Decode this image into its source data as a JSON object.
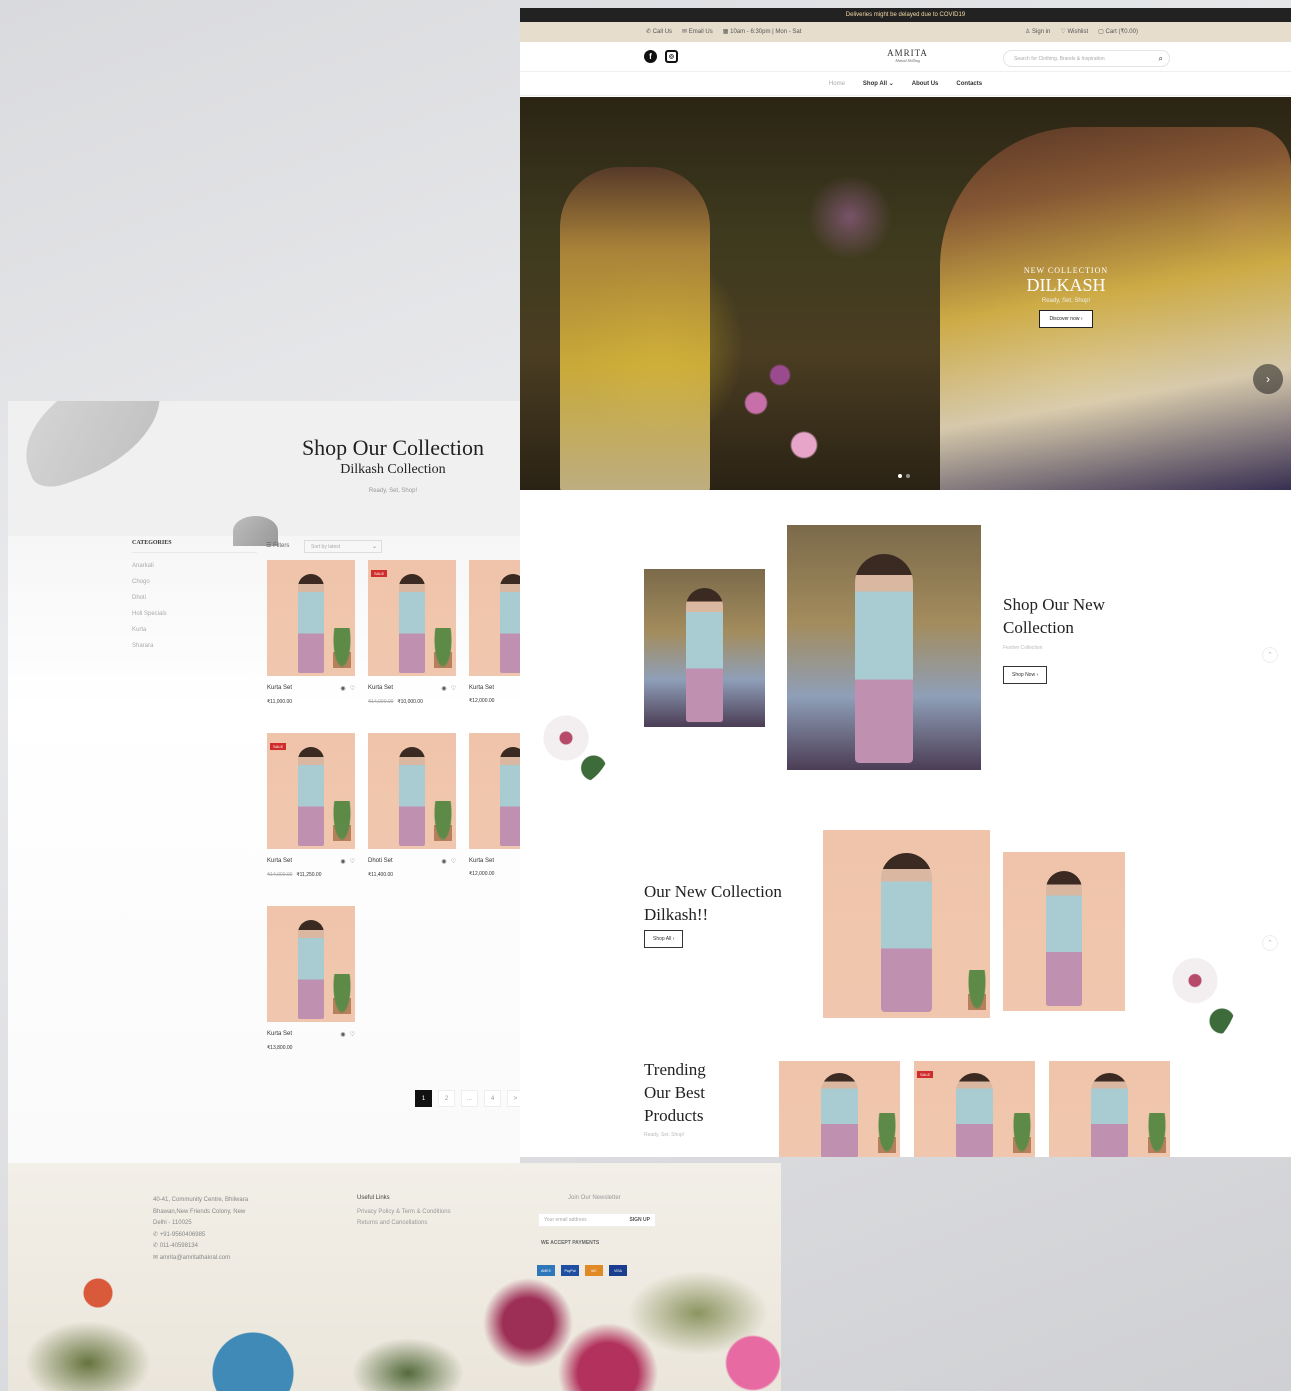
{
  "home": {
    "announcement": "Deliveries might be delayed due to COVID19",
    "topbar": {
      "call": "Call Us",
      "email": "Email Us",
      "hours": "10am - 6:30pm | Mon - Sat",
      "signin": "Sign in",
      "wishlist": "Wishlist",
      "cart": "Cart (₹0.00)"
    },
    "logo": {
      "name": "AMRITA",
      "tagline": "Ahmad Shilling"
    },
    "search_placeholder": "Search for Clothing, Brands & Inspiration",
    "nav": [
      "Home",
      "Shop All",
      "About Us",
      "Contacts"
    ],
    "hero": {
      "kicker": "NEW COLLECTION",
      "title": "DILKASH",
      "subtitle": "Ready, Set, Shop!",
      "button": "Discover now"
    },
    "section1": {
      "title_line1": "Shop Our New",
      "title_line2": "Collection",
      "subtitle": "Festive Collection",
      "button": "Shop Now"
    },
    "section2": {
      "title_line1": "Our New Collection",
      "title_line2": "Dilkash!!",
      "button": "Shop All"
    },
    "section3": {
      "title_line1": "Trending",
      "title_line2": "Our Best",
      "title_line3": "Products",
      "subtitle": "Ready, Set, Shop!",
      "sale": "SALE"
    }
  },
  "shop": {
    "banner": {
      "title": "Shop Our Collection",
      "subtitle": "Dilkash Collection",
      "tagline": "Ready, Set, Shop!"
    },
    "categories_title": "CATEGORIES",
    "categories": [
      "Anarkali",
      "Chogo",
      "Dhoti",
      "Holi Specials",
      "Kurta",
      "Sharara"
    ],
    "filters_label": "Filters",
    "sort_label": "Sort by latest",
    "sale_label": "SALE",
    "products": [
      {
        "name": "Kurta Set",
        "old_price": "",
        "price": "₹11,000.00"
      },
      {
        "name": "Kurta Set",
        "old_price": "₹14,000.00",
        "price": "₹10,000.00"
      },
      {
        "name": "Kurta Set",
        "old_price": "",
        "price": "₹12,000.00"
      },
      {
        "name": "Kurta Set",
        "old_price": "₹14,000.00",
        "price": "₹11,250.00"
      },
      {
        "name": "Dhoti Set",
        "old_price": "",
        "price": "₹11,400.00"
      },
      {
        "name": "Kurta Set",
        "old_price": "",
        "price": "₹12,000.00"
      },
      {
        "name": "Kurta Set",
        "old_price": "",
        "price": "₹13,800.00"
      }
    ],
    "pagination": [
      "1",
      "2",
      "...",
      "4",
      ">"
    ]
  },
  "footer": {
    "address": [
      "40-41, Community Centre, Bhilwara",
      "Bhawan,New Friends Colony, New",
      "Delhi - 110025",
      "+91-9560406985",
      "011-40598134",
      "amrita@amritathakral.com"
    ],
    "links_title": "Useful Links",
    "links": [
      "Privacy Policy & Term & Conditions",
      "Returns and Cancellations"
    ],
    "newsletter_title": "Join Our Newsletter",
    "newsletter_placeholder": "Your email address",
    "signup": "SIGN UP",
    "accept": "WE ACCEPT PAYMENTS",
    "cards": [
      "AMEX",
      "PayPal",
      "MC",
      "VISA"
    ]
  },
  "colors": {
    "announcement_bg": "#222222",
    "topbar_bg": "#e6ddcd",
    "sale_badge": "#d02c2c",
    "peach_backdrop": "#f0c5ab"
  }
}
